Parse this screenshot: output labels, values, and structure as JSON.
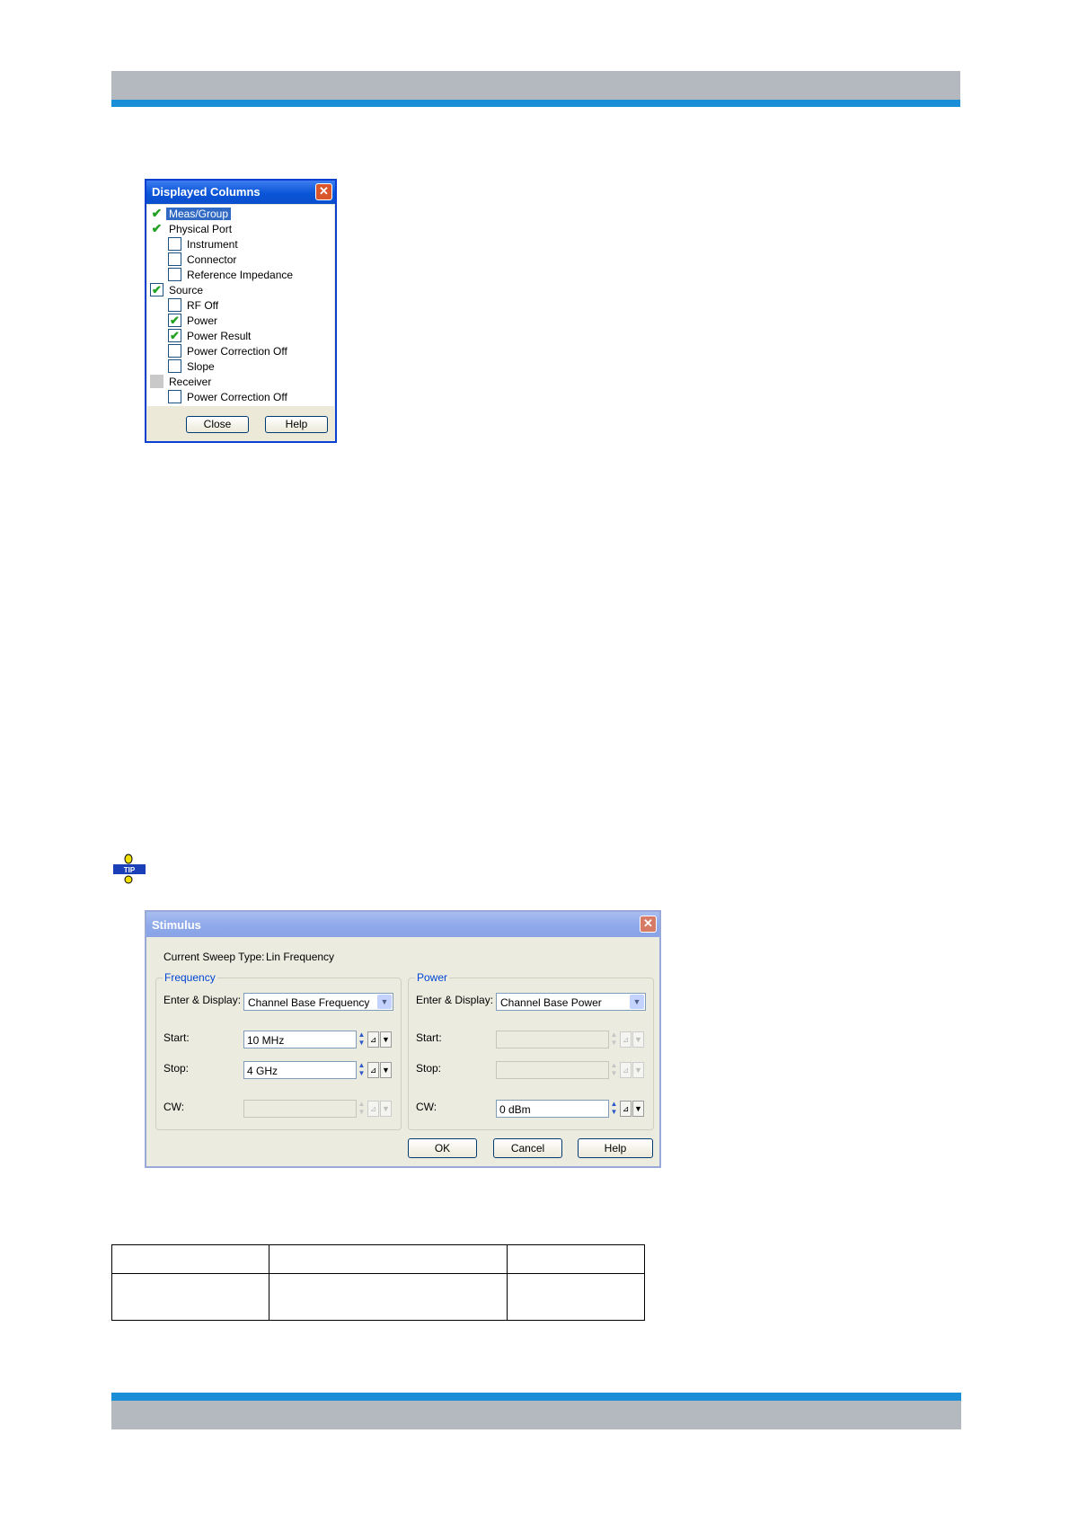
{
  "displayed_columns": {
    "title": "Displayed Columns",
    "close_glyph": "✕",
    "items": [
      {
        "label": "Meas/Group",
        "state": "checked",
        "selected": true
      },
      {
        "label": "Physical Port",
        "state": "checked"
      },
      {
        "label": "Instrument",
        "state": "unchecked"
      },
      {
        "label": "Connector",
        "state": "unchecked"
      },
      {
        "label": "Reference Impedance",
        "state": "unchecked"
      },
      {
        "label": "Source",
        "state": "checked"
      },
      {
        "label": "RF Off",
        "state": "unchecked"
      },
      {
        "label": "Power",
        "state": "checked"
      },
      {
        "label": "Power Result",
        "state": "checked"
      },
      {
        "label": "Power Correction Off",
        "state": "unchecked"
      },
      {
        "label": "Slope",
        "state": "unchecked"
      },
      {
        "label": "Receiver",
        "state": "indeterminate"
      },
      {
        "label": "Power Correction Off",
        "state": "unchecked"
      }
    ],
    "buttons": {
      "close": "Close",
      "help": "Help"
    }
  },
  "tip_icon": {
    "text": "TIP",
    "color": "#1a3fb8",
    "accent": "#f0e000"
  },
  "stimulus": {
    "title": "Stimulus",
    "close_glyph": "✕",
    "sweep_type_label": "Current Sweep Type:",
    "sweep_type_value": "Lin Frequency",
    "frequency": {
      "group_label": "Frequency",
      "enter_display_label": "Enter & Display:",
      "enter_display_value": "Channel Base Frequency",
      "start_label": "Start:",
      "start_value": "10 MHz",
      "stop_label": "Stop:",
      "stop_value": "4 GHz",
      "cw_label": "CW:",
      "cw_value": ""
    },
    "power": {
      "group_label": "Power",
      "enter_display_label": "Enter & Display:",
      "enter_display_value": "Channel Base Power",
      "start_label": "Start:",
      "start_value": "",
      "stop_label": "Stop:",
      "stop_value": "",
      "cw_label": "CW:",
      "cw_value": "0 dBm"
    },
    "buttons": {
      "ok": "OK",
      "cancel": "Cancel",
      "help": "Help"
    }
  },
  "colors": {
    "header_gray": "#b4b9c0",
    "header_blue": "#1a8fd8",
    "xp_blue": "#0a55d8"
  }
}
